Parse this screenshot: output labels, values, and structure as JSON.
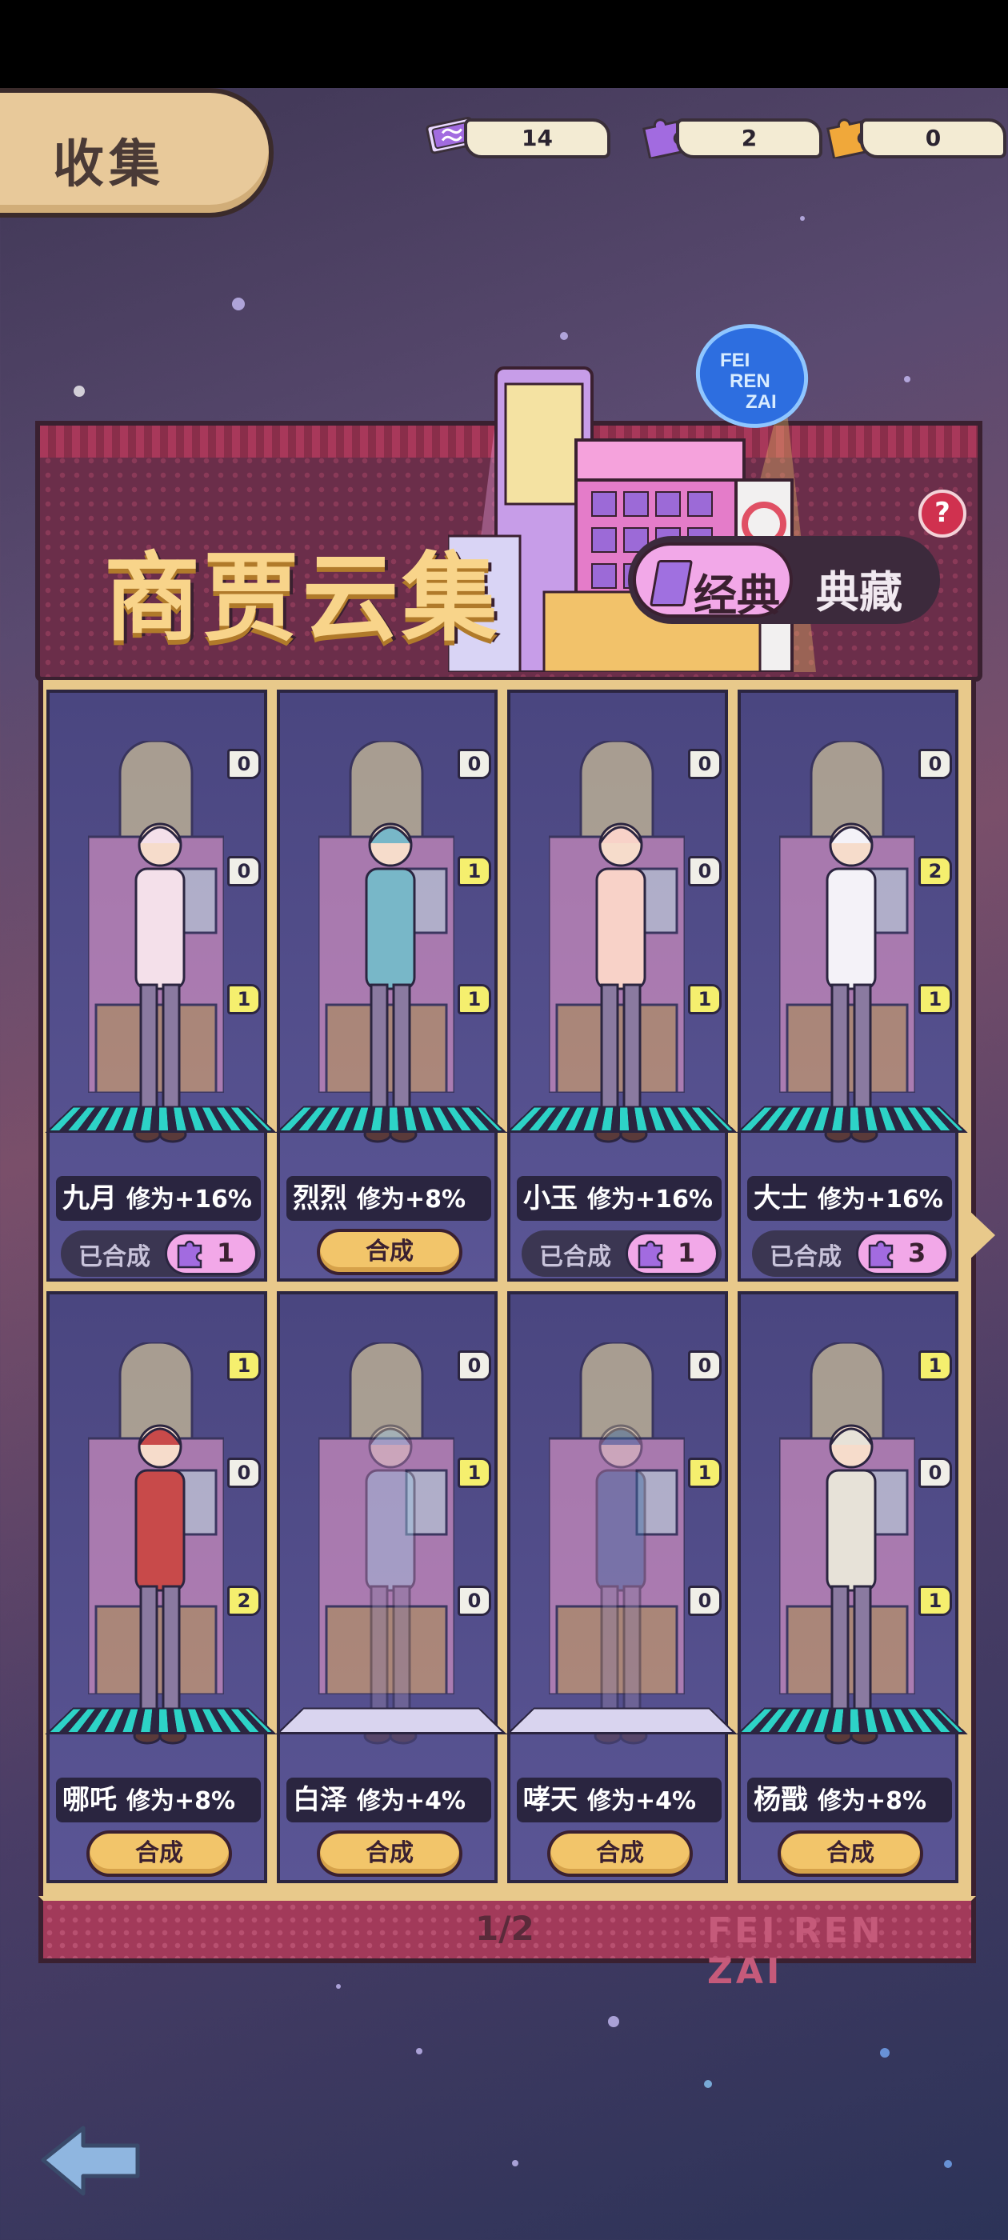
{
  "screen_title": "收集",
  "currencies": [
    {
      "name": "ticket-icon",
      "value": "14",
      "color": "#a26be0"
    },
    {
      "name": "puzzle-piece-icon",
      "value": "2",
      "color": "#a26be0"
    },
    {
      "name": "gold-puzzle-piece-icon",
      "value": "0",
      "color": "#f0a83a"
    }
  ],
  "collection": {
    "title": "商贾云集",
    "tabs": {
      "active": "经典",
      "inactive": "典藏"
    },
    "help": "?"
  },
  "cards": [
    {
      "name": "九月",
      "boost": "修为+16%",
      "badges": [
        "0",
        "0",
        "1"
      ],
      "status": "done",
      "done_label": "已合成",
      "count": "1"
    },
    {
      "name": "烈烈",
      "boost": "修为+8%",
      "badges": [
        "0",
        "1",
        "1"
      ],
      "status": "synth",
      "synth_label": "合成"
    },
    {
      "name": "小玉",
      "boost": "修为+16%",
      "badges": [
        "0",
        "0",
        "1"
      ],
      "status": "done",
      "done_label": "已合成",
      "count": "1"
    },
    {
      "name": "大士",
      "boost": "修为+16%",
      "badges": [
        "0",
        "2",
        "1"
      ],
      "status": "done",
      "done_label": "已合成",
      "count": "3"
    },
    {
      "name": "哪吒",
      "boost": "修为+8%",
      "badges": [
        "1",
        "0",
        "2"
      ],
      "status": "synth",
      "synth_label": "合成"
    },
    {
      "name": "白泽",
      "boost": "修为+4%",
      "badges": [
        "0",
        "1",
        "0"
      ],
      "status": "synth",
      "synth_label": "合成"
    },
    {
      "name": "哮天",
      "boost": "修为+4%",
      "badges": [
        "0",
        "1",
        "0"
      ],
      "status": "synth",
      "synth_label": "合成"
    },
    {
      "name": "杨戬",
      "boost": "修为+8%",
      "badges": [
        "1",
        "0",
        "1"
      ],
      "status": "synth",
      "synth_label": "合成"
    }
  ],
  "pagination": {
    "label": "1/2"
  },
  "brand": "FEI REN ZAI",
  "sign": {
    "line1": "FEI",
    "line2": "REN",
    "line3": "ZAI"
  }
}
